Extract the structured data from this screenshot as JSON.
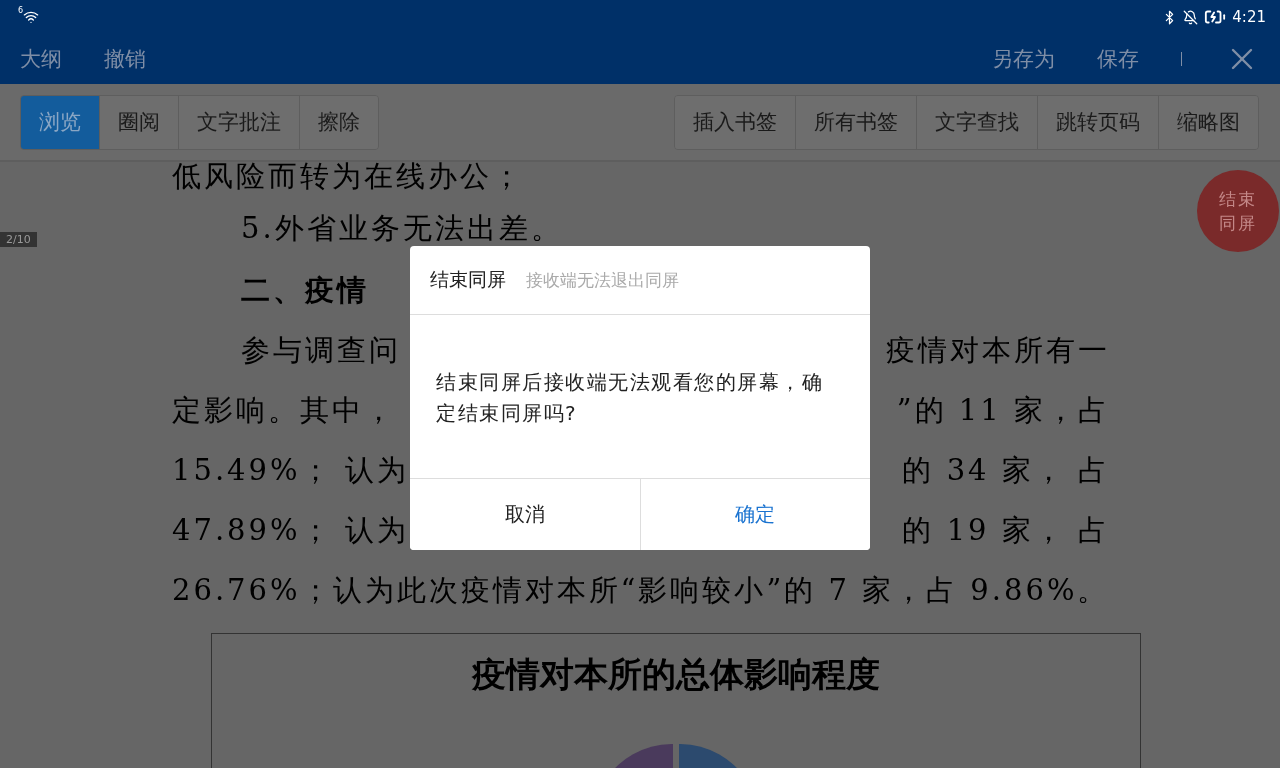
{
  "status_bar": {
    "network_badge": "6",
    "time": "4:21"
  },
  "header": {
    "left_actions": [
      "大纲",
      "撤销"
    ],
    "right_actions": [
      "另存为",
      "保存"
    ]
  },
  "mode_tabs": [
    {
      "label": "浏览",
      "selected": true
    },
    {
      "label": "圈阅",
      "selected": false
    },
    {
      "label": "文字批注",
      "selected": false
    },
    {
      "label": "擦除",
      "selected": false
    }
  ],
  "tools": [
    "插入书签",
    "所有书签",
    "文字查找",
    "跳转页码",
    "缩略图"
  ],
  "document": {
    "page_indicator": "2/10",
    "lines": [
      {
        "kind": "paragraph",
        "indent": false,
        "left": "低风险而转为在线办公；"
      },
      {
        "kind": "paragraph",
        "indent": true,
        "left": "5.外省业务无法出差。"
      },
      {
        "kind": "heading",
        "indent": true,
        "left": "二、疫情"
      },
      {
        "kind": "paragraph",
        "indent": true,
        "left": "参与调查问",
        "right": "疫情对本所有一"
      },
      {
        "kind": "paragraph",
        "indent": false,
        "left": "定影响。其中，",
        "right": "”的 11 家，占"
      },
      {
        "kind": "paragraph",
        "indent": false,
        "left": "15.49%； 认为",
        "right": "的 34 家， 占"
      },
      {
        "kind": "paragraph",
        "indent": false,
        "left": "47.89%； 认为",
        "right": "的 19 家， 占"
      },
      {
        "kind": "paragraph",
        "indent": false,
        "left": "26.76%；认为此次疫情对本所“影响较小”的 7 家，占 9.86%。"
      }
    ],
    "chart": {
      "title": "疫情对本所的总体影响程度"
    }
  },
  "end_share_button": "结束同屏",
  "dialog": {
    "title": "结束同屏",
    "subtitle": "接收端无法退出同屏",
    "message": "结束同屏后接收端无法观看您的屏幕，确定结束同屏吗?",
    "buttons": [
      {
        "label": "取消",
        "kind": "cancel"
      },
      {
        "label": "确定",
        "kind": "confirm"
      }
    ]
  }
}
